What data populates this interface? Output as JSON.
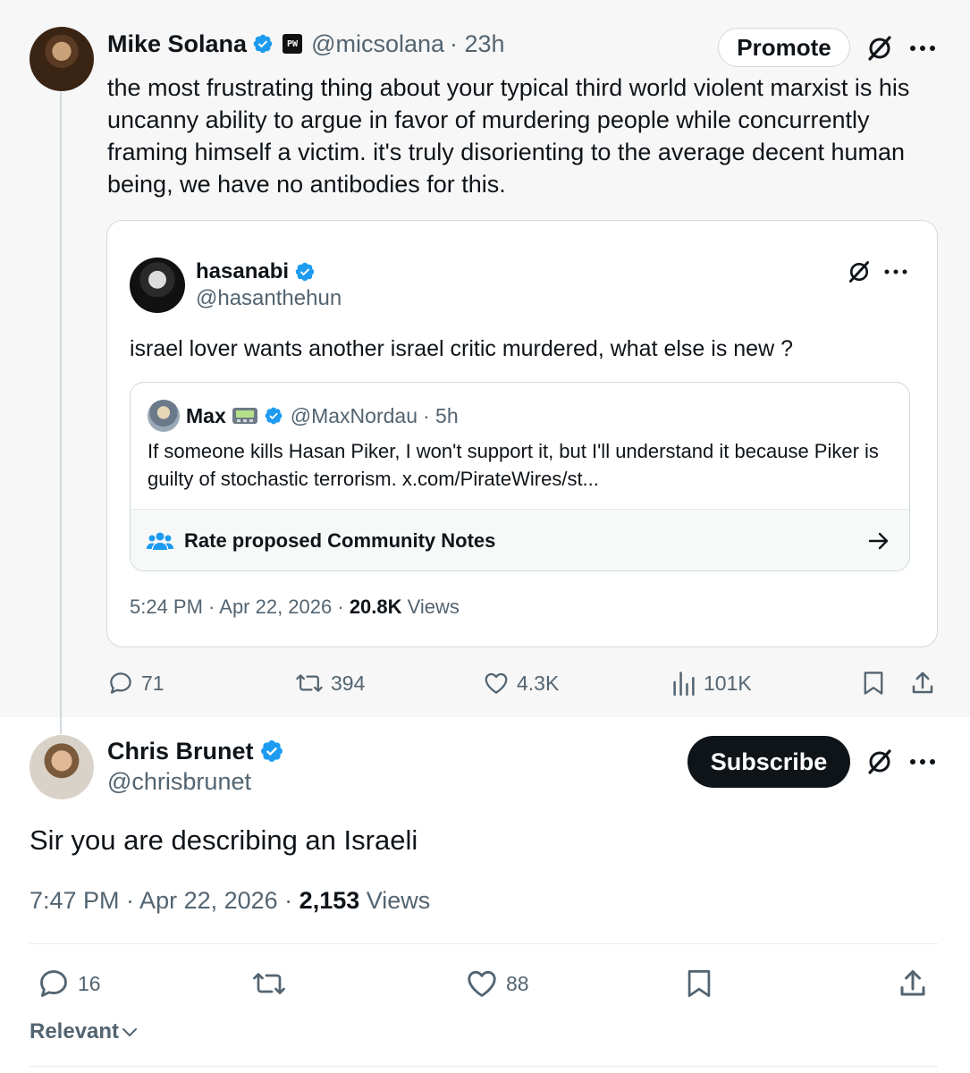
{
  "main_tweet": {
    "author_name": "Mike Solana",
    "badge": "PW",
    "handle": "@micsolana",
    "time": "· 23h",
    "promote_label": "Promote",
    "text": "the most frustrating thing about your typical third world violent marxist is his uncanny ability to argue in favor of murdering people while concurrently framing himself a victim. it's truly disorienting to the average decent human being, we have no antibodies for this.",
    "quote": {
      "author_name": "hasanabi",
      "handle": "@hasanthehun",
      "text": "israel lover wants another israel critic murdered, what else is new ?",
      "inner_quote": {
        "author_name": "Max",
        "handle": "@MaxNordau",
        "time": "· 5h",
        "text": "If someone kills Hasan Piker, I won't support it, but I'll understand it because Piker is guilty of stochastic terrorism. x.com/PirateWires/st...",
        "notes_label": "Rate proposed Community Notes"
      },
      "timestamp": "5:24 PM · Apr 22, 2026 · ",
      "views_count": "20.8K",
      "views_label": " Views"
    },
    "stats": {
      "replies": "71",
      "reposts": "394",
      "likes": "4.3K",
      "views": "101K"
    }
  },
  "reply": {
    "author_name": "Chris Brunet",
    "handle": "@chrisbrunet",
    "subscribe_label": "Subscribe",
    "text": "Sir you are describing an Israeli",
    "timestamp": "7:47 PM · Apr 22, 2026 · ",
    "views_count": "2,153",
    "views_label": " Views",
    "stats": {
      "replies": "16",
      "likes": "88"
    }
  },
  "sort_label": "Relevant",
  "colors": {
    "verified_blue": "#1d9bf0",
    "text_primary": "#0f1419",
    "text_secondary": "#536471",
    "border": "#cfd9de"
  }
}
